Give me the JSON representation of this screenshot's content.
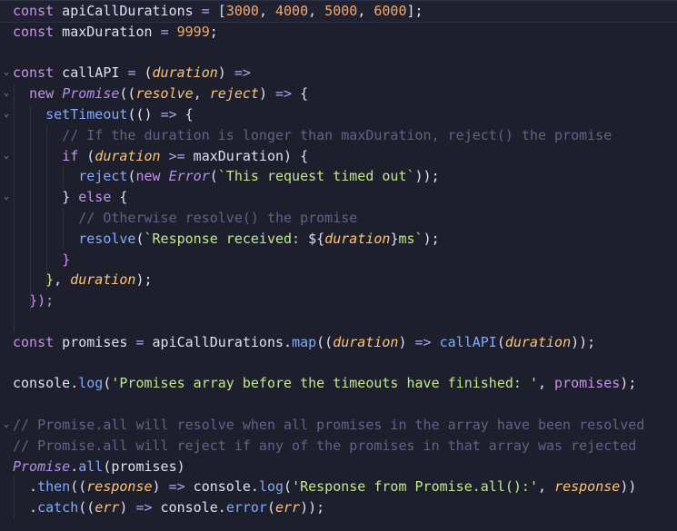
{
  "theme": {
    "background": "#1e1f2c",
    "plain": "#e0dff5",
    "keyword": "#c792ea",
    "type": "#b490ea",
    "func": "#82aaff",
    "number": "#f7a96b",
    "param": "#ffc476",
    "string": "#c3e88d",
    "comment": "#5f6387",
    "operator": "#b0a4f5",
    "cursorLine": "#202232"
  },
  "editor": {
    "fold_icon": "chevron-down-icon",
    "lines": [
      {
        "fold": false,
        "highlight": true,
        "tokens": [
          {
            "t": "const",
            "c": "keyword"
          },
          {
            "t": " apiCallDurations ",
            "c": "plain"
          },
          {
            "t": "=",
            "c": "operator"
          },
          {
            "t": " [",
            "c": "plain"
          },
          {
            "t": "3000",
            "c": "number"
          },
          {
            "t": ", ",
            "c": "plain"
          },
          {
            "t": "4000",
            "c": "number"
          },
          {
            "t": ", ",
            "c": "plain"
          },
          {
            "t": "5000",
            "c": "number"
          },
          {
            "t": ", ",
            "c": "plain"
          },
          {
            "t": "6000",
            "c": "number"
          },
          {
            "t": "];",
            "c": "plain"
          }
        ]
      },
      {
        "fold": false,
        "tokens": [
          {
            "t": "const",
            "c": "keyword"
          },
          {
            "t": " maxDuration ",
            "c": "plain"
          },
          {
            "t": "=",
            "c": "operator"
          },
          {
            "t": " ",
            "c": "plain"
          },
          {
            "t": "9999",
            "c": "number"
          },
          {
            "t": ";",
            "c": "plain"
          }
        ]
      },
      {
        "fold": false,
        "tokens": []
      },
      {
        "fold": true,
        "tokens": [
          {
            "t": "const",
            "c": "keyword"
          },
          {
            "t": " callAPI ",
            "c": "plain"
          },
          {
            "t": "=",
            "c": "operator"
          },
          {
            "t": " (",
            "c": "plain"
          },
          {
            "t": "duration",
            "c": "param"
          },
          {
            "t": ") ",
            "c": "plain"
          },
          {
            "t": "=>",
            "c": "operator"
          }
        ]
      },
      {
        "fold": true,
        "tokens": [
          {
            "t": "  ",
            "c": "plain"
          },
          {
            "t": "new",
            "c": "keyword"
          },
          {
            "t": " ",
            "c": "plain"
          },
          {
            "t": "Promise",
            "c": "type"
          },
          {
            "t": "((",
            "c": "plain"
          },
          {
            "t": "resolve",
            "c": "param"
          },
          {
            "t": ", ",
            "c": "plain"
          },
          {
            "t": "reject",
            "c": "param"
          },
          {
            "t": ") ",
            "c": "plain"
          },
          {
            "t": "=>",
            "c": "operator"
          },
          {
            "t": " {",
            "c": "plain"
          }
        ]
      },
      {
        "fold": true,
        "tokens": [
          {
            "t": "    ",
            "c": "plain"
          },
          {
            "t": "setTimeout",
            "c": "func"
          },
          {
            "t": "(() ",
            "c": "plain"
          },
          {
            "t": "=>",
            "c": "operator"
          },
          {
            "t": " {",
            "c": "plain"
          }
        ]
      },
      {
        "fold": false,
        "tokens": [
          {
            "t": "      ",
            "c": "plain"
          },
          {
            "t": "// If the duration is longer than maxDuration, reject() the promise",
            "c": "comment"
          }
        ]
      },
      {
        "fold": true,
        "tokens": [
          {
            "t": "      ",
            "c": "plain"
          },
          {
            "t": "if",
            "c": "keyword"
          },
          {
            "t": " (",
            "c": "plain"
          },
          {
            "t": "duration",
            "c": "param"
          },
          {
            "t": " ",
            "c": "plain"
          },
          {
            "t": ">=",
            "c": "operator"
          },
          {
            "t": " maxDuration) {",
            "c": "plain"
          }
        ]
      },
      {
        "fold": false,
        "tokens": [
          {
            "t": "        ",
            "c": "plain"
          },
          {
            "t": "reject",
            "c": "func"
          },
          {
            "t": "(",
            "c": "plain"
          },
          {
            "t": "new",
            "c": "keyword"
          },
          {
            "t": " ",
            "c": "plain"
          },
          {
            "t": "Error",
            "c": "type"
          },
          {
            "t": "(",
            "c": "plain"
          },
          {
            "t": "`This request timed out`",
            "c": "string"
          },
          {
            "t": "));",
            "c": "plain"
          }
        ]
      },
      {
        "fold": true,
        "tokens": [
          {
            "t": "      ",
            "c": "plain"
          },
          {
            "t": "}",
            "c": "plain"
          },
          {
            "t": " else ",
            "c": "keyword"
          },
          {
            "t": "{",
            "c": "plain"
          }
        ]
      },
      {
        "fold": false,
        "tokens": [
          {
            "t": "        ",
            "c": "plain"
          },
          {
            "t": "// Otherwise resolve() the promise",
            "c": "comment"
          }
        ]
      },
      {
        "fold": false,
        "tokens": [
          {
            "t": "        ",
            "c": "plain"
          },
          {
            "t": "resolve",
            "c": "func"
          },
          {
            "t": "(",
            "c": "plain"
          },
          {
            "t": "`Response received: ",
            "c": "string"
          },
          {
            "t": "${",
            "c": "plain"
          },
          {
            "t": "duration",
            "c": "param"
          },
          {
            "t": "}",
            "c": "plain"
          },
          {
            "t": "ms`",
            "c": "string"
          },
          {
            "t": ");",
            "c": "plain"
          }
        ]
      },
      {
        "fold": false,
        "tokens": [
          {
            "t": "      ",
            "c": "plain"
          },
          {
            "t": "}",
            "c": "keyword"
          }
        ]
      },
      {
        "fold": false,
        "tokens": [
          {
            "t": "    ",
            "c": "plain"
          },
          {
            "t": "}",
            "c": "string"
          },
          {
            "t": ", ",
            "c": "plain"
          },
          {
            "t": "duration",
            "c": "param"
          },
          {
            "t": ");",
            "c": "plain"
          }
        ]
      },
      {
        "fold": false,
        "tokens": [
          {
            "t": "  ",
            "c": "plain"
          },
          {
            "t": "});",
            "c": "keyword"
          }
        ]
      },
      {
        "fold": false,
        "tokens": []
      },
      {
        "fold": false,
        "tokens": [
          {
            "t": "const",
            "c": "keyword"
          },
          {
            "t": " promises ",
            "c": "plain"
          },
          {
            "t": "=",
            "c": "operator"
          },
          {
            "t": " apiCallDurations.",
            "c": "plain"
          },
          {
            "t": "map",
            "c": "func"
          },
          {
            "t": "((",
            "c": "plain"
          },
          {
            "t": "duration",
            "c": "param"
          },
          {
            "t": ") ",
            "c": "plain"
          },
          {
            "t": "=>",
            "c": "operator"
          },
          {
            "t": " ",
            "c": "plain"
          },
          {
            "t": "callAPI",
            "c": "func"
          },
          {
            "t": "(",
            "c": "plain"
          },
          {
            "t": "duration",
            "c": "param"
          },
          {
            "t": "));",
            "c": "plain"
          }
        ]
      },
      {
        "fold": false,
        "tokens": []
      },
      {
        "fold": false,
        "tokens": [
          {
            "t": "console.",
            "c": "plain"
          },
          {
            "t": "log",
            "c": "func"
          },
          {
            "t": "(",
            "c": "plain"
          },
          {
            "t": "'Promises array before the timeouts have finished: '",
            "c": "string"
          },
          {
            "t": ", ",
            "c": "plain"
          },
          {
            "t": "promises",
            "c": "keyword"
          },
          {
            "t": ");",
            "c": "plain"
          }
        ]
      },
      {
        "fold": false,
        "tokens": []
      },
      {
        "fold": true,
        "tokens": [
          {
            "t": "// Promise.all will resolve when all promises in the array have been resolved",
            "c": "comment"
          }
        ]
      },
      {
        "fold": false,
        "tokens": [
          {
            "t": "// Promise.all will reject if any of the promises in that array was rejected",
            "c": "comment"
          }
        ]
      },
      {
        "fold": false,
        "tokens": [
          {
            "t": "Promise",
            "c": "type"
          },
          {
            "t": ".",
            "c": "plain"
          },
          {
            "t": "all",
            "c": "func"
          },
          {
            "t": "(promises)",
            "c": "plain"
          }
        ]
      },
      {
        "fold": false,
        "tokens": [
          {
            "t": "  .",
            "c": "plain"
          },
          {
            "t": "then",
            "c": "func"
          },
          {
            "t": "((",
            "c": "plain"
          },
          {
            "t": "response",
            "c": "param"
          },
          {
            "t": ") ",
            "c": "plain"
          },
          {
            "t": "=>",
            "c": "operator"
          },
          {
            "t": " console.",
            "c": "plain"
          },
          {
            "t": "log",
            "c": "func"
          },
          {
            "t": "(",
            "c": "plain"
          },
          {
            "t": "'Response from Promise.all():'",
            "c": "string"
          },
          {
            "t": ", ",
            "c": "plain"
          },
          {
            "t": "response",
            "c": "param"
          },
          {
            "t": "))",
            "c": "plain"
          }
        ]
      },
      {
        "fold": false,
        "tokens": [
          {
            "t": "  .",
            "c": "plain"
          },
          {
            "t": "catch",
            "c": "func"
          },
          {
            "t": "((",
            "c": "plain"
          },
          {
            "t": "err",
            "c": "param"
          },
          {
            "t": ") ",
            "c": "plain"
          },
          {
            "t": "=>",
            "c": "operator"
          },
          {
            "t": " console.",
            "c": "plain"
          },
          {
            "t": "error",
            "c": "func"
          },
          {
            "t": "(",
            "c": "plain"
          },
          {
            "t": "err",
            "c": "param"
          },
          {
            "t": "));",
            "c": "plain"
          }
        ]
      }
    ]
  }
}
